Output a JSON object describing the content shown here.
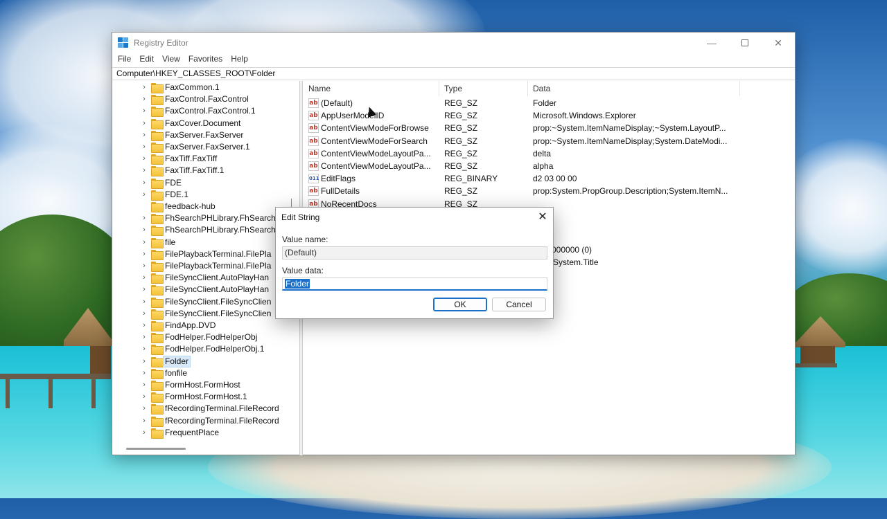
{
  "window": {
    "title": "Registry Editor",
    "controls": {
      "minimize": "—",
      "close": "✕"
    }
  },
  "menu": [
    "File",
    "Edit",
    "View",
    "Favorites",
    "Help"
  ],
  "address": "Computer\\HKEY_CLASSES_ROOT\\Folder",
  "tree": {
    "items": [
      {
        "label": "FaxCommon.1",
        "expandable": true
      },
      {
        "label": "FaxControl.FaxControl",
        "expandable": true
      },
      {
        "label": "FaxControl.FaxControl.1",
        "expandable": true
      },
      {
        "label": "FaxCover.Document",
        "expandable": true
      },
      {
        "label": "FaxServer.FaxServer",
        "expandable": true
      },
      {
        "label": "FaxServer.FaxServer.1",
        "expandable": true
      },
      {
        "label": "FaxTiff.FaxTiff",
        "expandable": true
      },
      {
        "label": "FaxTiff.FaxTiff.1",
        "expandable": true
      },
      {
        "label": "FDE",
        "expandable": true
      },
      {
        "label": "FDE.1",
        "expandable": true
      },
      {
        "label": "feedback-hub",
        "expandable": false
      },
      {
        "label": "FhSearchPHLibrary.FhSearch",
        "expandable": true
      },
      {
        "label": "FhSearchPHLibrary.FhSearch",
        "expandable": true
      },
      {
        "label": "file",
        "expandable": true
      },
      {
        "label": "FilePlaybackTerminal.FilePla",
        "expandable": true
      },
      {
        "label": "FilePlaybackTerminal.FilePla",
        "expandable": true
      },
      {
        "label": "FileSyncClient.AutoPlayHan",
        "expandable": true
      },
      {
        "label": "FileSyncClient.AutoPlayHan",
        "expandable": true
      },
      {
        "label": "FileSyncClient.FileSyncClien",
        "expandable": true
      },
      {
        "label": "FileSyncClient.FileSyncClien",
        "expandable": true
      },
      {
        "label": "FindApp.DVD",
        "expandable": true
      },
      {
        "label": "FodHelper.FodHelperObj",
        "expandable": true
      },
      {
        "label": "FodHelper.FodHelperObj.1",
        "expandable": true
      },
      {
        "label": "Folder",
        "expandable": true,
        "selected": true
      },
      {
        "label": "fonfile",
        "expandable": true
      },
      {
        "label": "FormHost.FormHost",
        "expandable": true
      },
      {
        "label": "FormHost.FormHost.1",
        "expandable": true
      },
      {
        "label": "fRecordingTerminal.FileRecord",
        "expandable": true
      },
      {
        "label": "fRecordingTerminal.FileRecord",
        "expandable": true
      },
      {
        "label": "FrequentPlace",
        "expandable": true
      }
    ]
  },
  "values": {
    "columns": [
      "Name",
      "Type",
      "Data"
    ],
    "rows": [
      {
        "name": "(Default)",
        "type": "REG_SZ",
        "data": "Folder",
        "icon": "ab"
      },
      {
        "name": "AppUserModelID",
        "type": "REG_SZ",
        "data": "Microsoft.Windows.Explorer",
        "icon": "ab"
      },
      {
        "name": "ContentViewModeForBrowse",
        "type": "REG_SZ",
        "data": "prop:~System.ItemNameDisplay;~System.LayoutP...",
        "icon": "ab"
      },
      {
        "name": "ContentViewModeForSearch",
        "type": "REG_SZ",
        "data": "prop:~System.ItemNameDisplay;System.DateModi...",
        "icon": "ab"
      },
      {
        "name": "ContentViewModeLayoutPa...",
        "type": "REG_SZ",
        "data": "delta",
        "icon": "ab"
      },
      {
        "name": "ContentViewModeLayoutPa...",
        "type": "REG_SZ",
        "data": "alpha",
        "icon": "ab"
      },
      {
        "name": "EditFlags",
        "type": "REG_BINARY",
        "data": "d2 03 00 00",
        "icon": "bin"
      },
      {
        "name": "FullDetails",
        "type": "REG_SZ",
        "data": "prop:System.PropGroup.Description;System.ItemN...",
        "icon": "ab"
      },
      {
        "name": "NoRecentDocs",
        "type": "REG_SZ",
        "data": "",
        "icon": "ab"
      }
    ],
    "partial_data": [
      "000000 (0)",
      "System.Title"
    ]
  },
  "dialog": {
    "title": "Edit String",
    "value_name_label": "Value name:",
    "value_name": "(Default)",
    "value_data_label": "Value data:",
    "value_data": "Folder",
    "ok": "OK",
    "cancel": "Cancel",
    "close": "✕"
  },
  "icons": {
    "app": "registry-icon",
    "string_value": "ab",
    "binary_value": "011"
  }
}
